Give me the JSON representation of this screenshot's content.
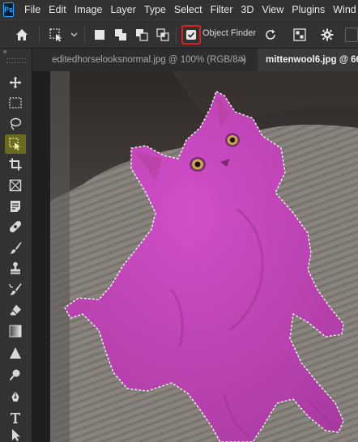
{
  "app": {
    "logo": "Ps",
    "menu": [
      "File",
      "Edit",
      "Image",
      "Layer",
      "Type",
      "Select",
      "Filter",
      "3D",
      "View",
      "Plugins",
      "Wind"
    ]
  },
  "options_bar": {
    "home_icon": "home-icon",
    "tool_preset_icon": "object-selection-icon",
    "object_finder_label": "Object Finder",
    "object_finder_checked": true,
    "highlight_color": "#e0201c"
  },
  "tabs": [
    {
      "label": "editedhorselooksnormal.jpg @ 100% (RGB/8#)",
      "active": false,
      "close": "×"
    },
    {
      "label": "mittenwool6.jpg @ 66",
      "active": true
    }
  ],
  "toolbar": {
    "collapse_label": "»",
    "active_tool": "object-selection-tool"
  },
  "colors": {
    "selection_overlay": "#c040b8",
    "carpet": "#8a857c",
    "accent": "#e0201c"
  }
}
